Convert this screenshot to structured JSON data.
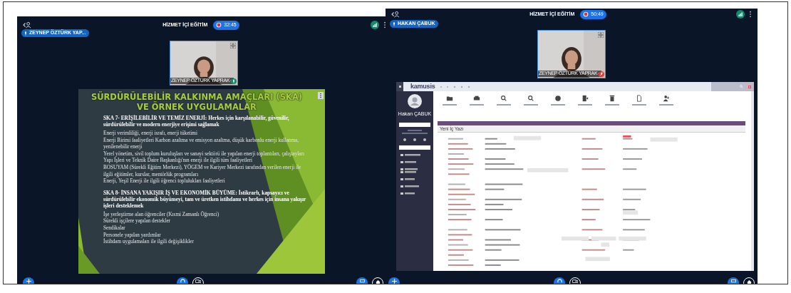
{
  "screens": [
    {
      "kind": "slide",
      "title": "HİZMET İÇİ EĞİTİM",
      "timer": "32:45",
      "presenter_badge": "ZEYNEP ÖZTÜRK YAP...",
      "video_tile": {
        "caption": "ZEYNEP ÖZTÜRK YAPRAK",
        "muted": false,
        "kind": "picture"
      },
      "slide": {
        "title": "SÜRDÜRÜLEBİLİR KALKINMA AMAÇLARI (SKA) VE ÖRNEK UYGULAMALAR",
        "sections": [
          {
            "heading": "SKA 7- ERİŞİLEBİLİR VE TEMİZ ENERJİ: Herkes için karşılanabilir, güvenilir, sürdürülebilir ve modern enerjiye erişimi sağlamak",
            "items": [
              "Enerji verimliliği, enerji israfı, enerji tüketimi",
              "Enerji Birimi faaliyetleri Karbon azaltma ve emisyon azaltma, düşük karbonlu enerji kullanma, yenilenebilir enerji",
              "Yerel yönetim, sivil toplum kuruluşları ve sanayi sektörü ile yapılan enerji toplantıları, çalıştayları",
              "Yapı İşleri ve Teknik Daire Başkanlığı'nın enerji ile ilgili tüm faaliyetleri",
              "BOSUYAM (Sürekli Eğitim Merkezi), YÖGEM ve Kariyer Merkezi tarafından verilen enerji ile ilgili eğitimler, kurslar, mentörlük programları",
              "Enerji, Yeşil Enerji ile ilgili öğrenci toplulukları faaliyetleri"
            ]
          },
          {
            "heading": "SKA 8- İNSANA YAKIŞIR İŞ VE EKONOMİK BÜYÜME: İstikrarlı, kapsayıcı ve sürdürülebilir ekonomik büyümeyi, tam ve üretken istihdamı ve herkes için insana yakışır işleri desteklemek",
            "items": [
              "İşe yerleştirme alan öğrenciler (Kısmi Zamanlı Öğrenci)",
              "Sürekli işçilere yapılan destekler",
              "Sendikalar",
              "Personele yapılan yardımlar",
              "İstihdam uygulamaları ile ilgili değişiklikler"
            ]
          }
        ]
      }
    },
    {
      "kind": "app",
      "title": "HİZMET İÇİ EĞİTİM",
      "timer": "50:49",
      "presenter_badge": "HAKAN ÇABUK",
      "video_tile": {
        "caption": "ZEYNEP ÖZTÜRK YAPRAK",
        "muted": true,
        "kind": "picture"
      },
      "app": {
        "logo": "kamusis",
        "user_name": "Hakan ÇABUK",
        "page_title": "Yeni İç Yazı"
      }
    }
  ]
}
